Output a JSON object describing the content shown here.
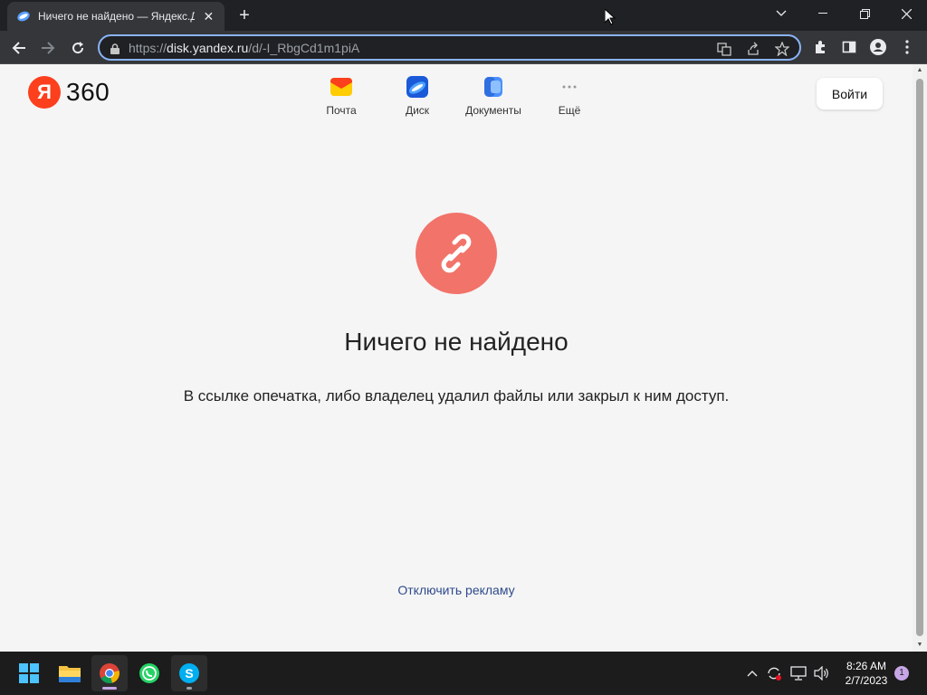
{
  "browser": {
    "tab_title": "Ничего не найдено — Яндекс.Д",
    "tab_close": "✕",
    "new_tab": "+",
    "url_prefix": "https://",
    "url_host": "disk.yandex.ru",
    "url_path": "/d/-I_RbgCd1m1piA"
  },
  "header": {
    "logo_letter": "Я",
    "logo_text": "360",
    "services": [
      {
        "label": "Почта",
        "icon": "mail-icon"
      },
      {
        "label": "Диск",
        "icon": "disk-icon"
      },
      {
        "label": "Документы",
        "icon": "documents-icon"
      },
      {
        "label": "Ещё",
        "icon": "more-icon"
      }
    ],
    "login_label": "Войти"
  },
  "main": {
    "title": "Ничего не найдено",
    "message": "В ссылке опечатка, либо владелец удалил файлы или закрыл к ним доступ.",
    "ad_link": "Отключить рекламу"
  },
  "taskbar": {
    "time": "8:26 AM",
    "date": "2/7/2023",
    "notifications": "1"
  },
  "colors": {
    "yandex_red": "#fc3f1d",
    "error_circle": "#f2736a",
    "link_blue": "#2e4a8c"
  }
}
